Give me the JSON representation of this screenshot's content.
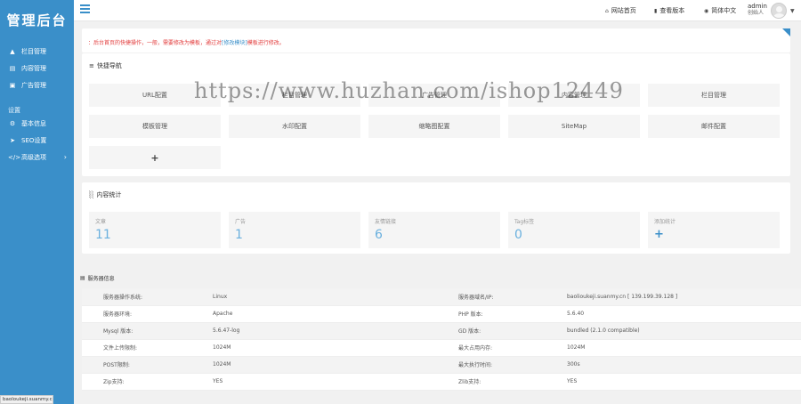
{
  "app": {
    "logo": "管理后台"
  },
  "sidebar": {
    "group1": [
      {
        "label": "栏目管理",
        "icon": "sitemap-icon"
      },
      {
        "label": "内容管理",
        "icon": "list-icon"
      },
      {
        "label": "广告管理",
        "icon": "image-icon"
      }
    ],
    "section_label": "设置",
    "group2": [
      {
        "label": "基本信息",
        "icon": "gear-icon"
      },
      {
        "label": "SEO设置",
        "icon": "send-icon"
      },
      {
        "label": "高级选项",
        "icon": "code-icon"
      }
    ]
  },
  "header": {
    "links": [
      {
        "label": "网站首页",
        "icon": "home-icon"
      },
      {
        "label": "查看版本",
        "icon": "bookmark-icon"
      },
      {
        "label": "简体中文",
        "icon": "globe-icon"
      }
    ],
    "user": {
      "name": "admin",
      "role": "创始人"
    }
  },
  "notice": {
    "text_before": "：后台首页的快捷操作，一般，需要修改为模板，通过对",
    "link": "[修改模块]",
    "text_after": "模板进行修改。"
  },
  "quick": {
    "title": "快捷导航",
    "items": [
      "URL配置",
      "栏目管理",
      "广告管理",
      "内容管理",
      "栏目管理",
      "模板管理",
      "水印配置",
      "缩略图配置",
      "SiteMap",
      "邮件配置"
    ],
    "add": "+"
  },
  "stats": {
    "title": "内容统计",
    "items": [
      {
        "label": "文章",
        "value": "11"
      },
      {
        "label": "广告",
        "value": "1"
      },
      {
        "label": "友情链接",
        "value": "6"
      },
      {
        "label": "Tag标签",
        "value": "0"
      },
      {
        "label": "添加统计",
        "value": "+"
      }
    ]
  },
  "server": {
    "title": "服务器信息",
    "rows": [
      [
        "服务器操作系统:",
        "Linux",
        "服务器域名/IP:",
        "baolioukeji.suanmy.cn [ 139.199.39.128 ]"
      ],
      [
        "服务器环境:",
        "Apache",
        "PHP 版本:",
        "5.6.40"
      ],
      [
        "Mysql 版本:",
        "5.6.47-log",
        "GD 版本:",
        "bundled (2.1.0 compatible)"
      ],
      [
        "文件上传限制:",
        "1024M",
        "最大占用内存:",
        "1024M"
      ],
      [
        "POST限制:",
        "1024M",
        "最大执行时间:",
        "300s"
      ],
      [
        "Zip支持:",
        "YES",
        "Zlib支持:",
        "YES"
      ]
    ]
  },
  "status_url": "baoloukeji.suanmy.cn",
  "watermark": "https://www.huzhan.com/ishop12449",
  "colors": {
    "primary": "#3a8fc9",
    "notice": "#e23c3c",
    "stat_value": "#6ab0de"
  }
}
